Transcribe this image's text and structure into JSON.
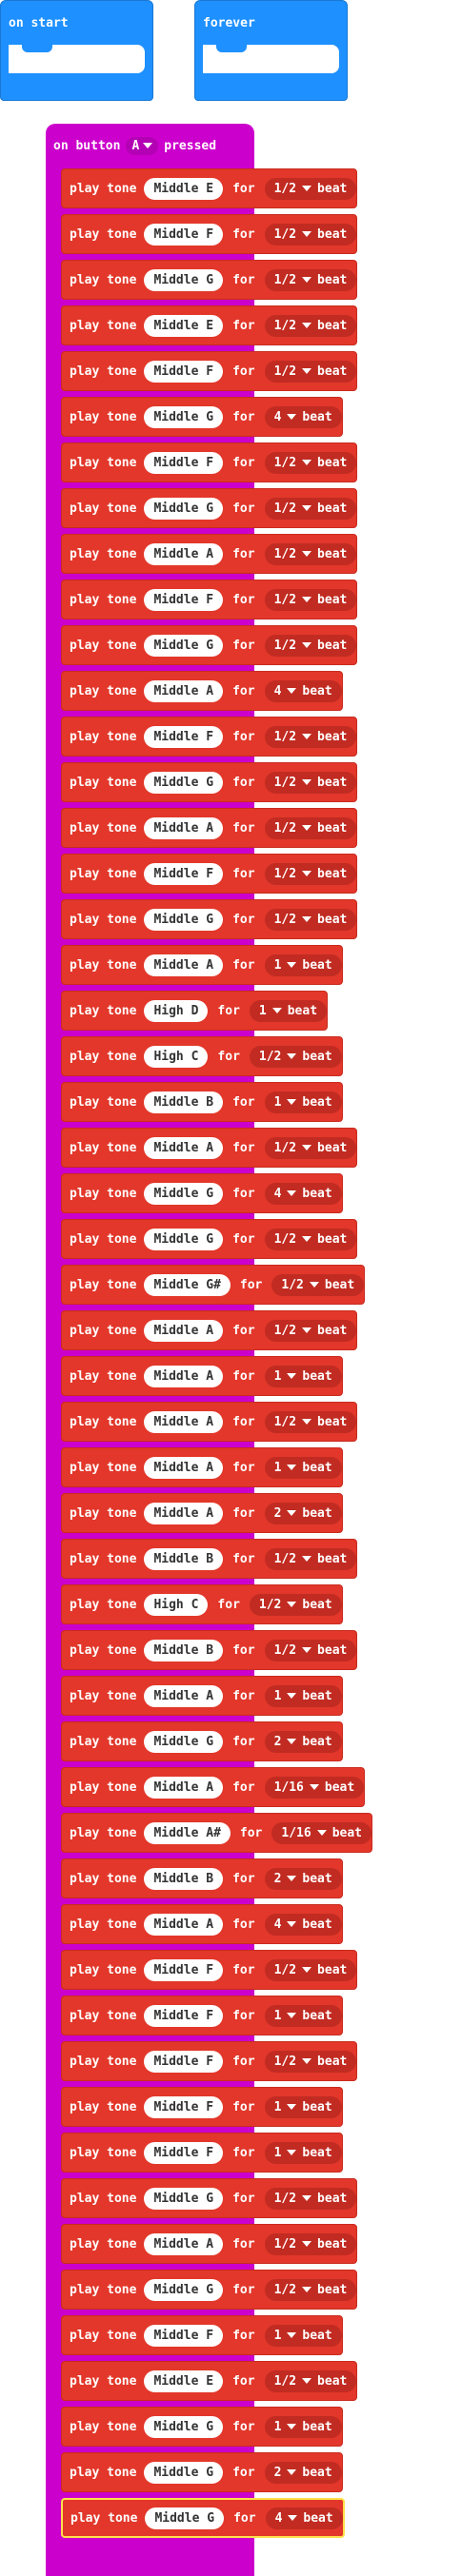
{
  "on_start": {
    "label": "on start"
  },
  "forever": {
    "label": "forever"
  },
  "event": {
    "prefix": "on button",
    "button": "A",
    "suffix": "pressed"
  },
  "block_words": {
    "play": "play tone",
    "for": "for",
    "beat": "beat"
  },
  "colors": {
    "events": "#cc00cc",
    "music": "#e2372a",
    "basic": "#1e90ff"
  },
  "tones": [
    {
      "note": "Middle E",
      "dur": "1/2"
    },
    {
      "note": "Middle F",
      "dur": "1/2"
    },
    {
      "note": "Middle G",
      "dur": "1/2"
    },
    {
      "note": "Middle E",
      "dur": "1/2"
    },
    {
      "note": "Middle F",
      "dur": "1/2"
    },
    {
      "note": "Middle G",
      "dur": "4"
    },
    {
      "note": "Middle F",
      "dur": "1/2"
    },
    {
      "note": "Middle G",
      "dur": "1/2"
    },
    {
      "note": "Middle A",
      "dur": "1/2"
    },
    {
      "note": "Middle F",
      "dur": "1/2"
    },
    {
      "note": "Middle G",
      "dur": "1/2"
    },
    {
      "note": "Middle A",
      "dur": "4"
    },
    {
      "note": "Middle F",
      "dur": "1/2"
    },
    {
      "note": "Middle G",
      "dur": "1/2"
    },
    {
      "note": "Middle A",
      "dur": "1/2"
    },
    {
      "note": "Middle F",
      "dur": "1/2"
    },
    {
      "note": "Middle G",
      "dur": "1/2"
    },
    {
      "note": "Middle A",
      "dur": "1"
    },
    {
      "note": "High D",
      "dur": "1"
    },
    {
      "note": "High C",
      "dur": "1/2"
    },
    {
      "note": "Middle B",
      "dur": "1"
    },
    {
      "note": "Middle A",
      "dur": "1/2"
    },
    {
      "note": "Middle G",
      "dur": "4"
    },
    {
      "note": "Middle G",
      "dur": "1/2"
    },
    {
      "note": "Middle G#",
      "dur": "1/2"
    },
    {
      "note": "Middle A",
      "dur": "1/2"
    },
    {
      "note": "Middle A",
      "dur": "1"
    },
    {
      "note": "Middle A",
      "dur": "1/2"
    },
    {
      "note": "Middle A",
      "dur": "1"
    },
    {
      "note": "Middle A",
      "dur": "2"
    },
    {
      "note": "Middle B",
      "dur": "1/2"
    },
    {
      "note": "High C",
      "dur": "1/2"
    },
    {
      "note": "Middle B",
      "dur": "1/2"
    },
    {
      "note": "Middle A",
      "dur": "1"
    },
    {
      "note": "Middle G",
      "dur": "2"
    },
    {
      "note": "Middle A",
      "dur": "1/16"
    },
    {
      "note": "Middle A#",
      "dur": "1/16"
    },
    {
      "note": "Middle B",
      "dur": "2"
    },
    {
      "note": "Middle A",
      "dur": "4"
    },
    {
      "note": "Middle F",
      "dur": "1/2"
    },
    {
      "note": "Middle F",
      "dur": "1"
    },
    {
      "note": "Middle F",
      "dur": "1/2"
    },
    {
      "note": "Middle F",
      "dur": "1"
    },
    {
      "note": "Middle F",
      "dur": "1"
    },
    {
      "note": "Middle G",
      "dur": "1/2"
    },
    {
      "note": "Middle A",
      "dur": "1/2"
    },
    {
      "note": "Middle G",
      "dur": "1/2"
    },
    {
      "note": "Middle F",
      "dur": "1"
    },
    {
      "note": "Middle E",
      "dur": "1/2"
    },
    {
      "note": "Middle G",
      "dur": "1"
    },
    {
      "note": "Middle G",
      "dur": "2"
    },
    {
      "note": "Middle G",
      "dur": "4"
    }
  ],
  "selected_index": 51
}
